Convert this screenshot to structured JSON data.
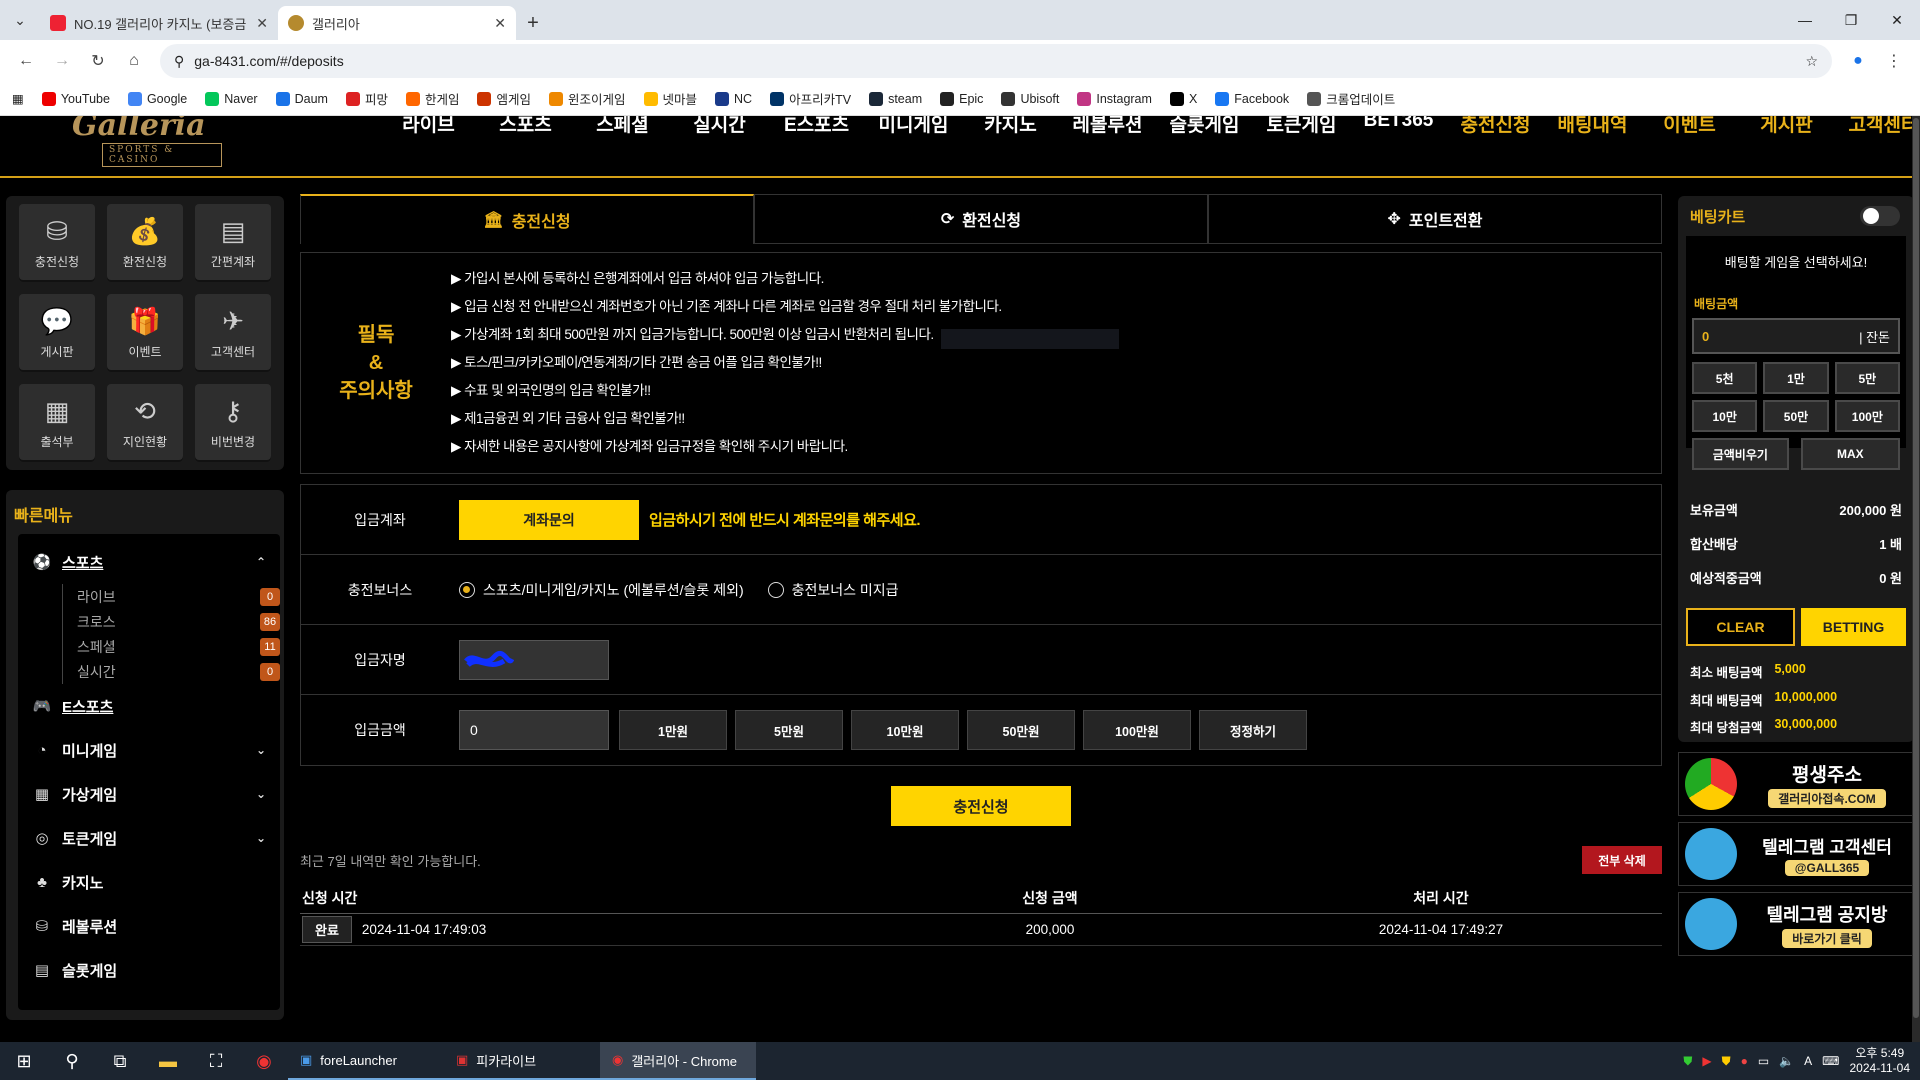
{
  "browser": {
    "tabs": [
      {
        "title": "NO.19 갤러리아 카지노 (보증금",
        "active": false
      },
      {
        "title": "갤러리아",
        "active": true
      }
    ],
    "url": "ga-8431.com/#/deposits",
    "bookmarks": [
      "YouTube",
      "Google",
      "Naver",
      "Daum",
      "피망",
      "한게임",
      "엠게임",
      "윈조이게임",
      "넷마블",
      "NC",
      "아프리카TV",
      "steam",
      "Epic",
      "Ubisoft",
      "Instagram",
      "X",
      "Facebook",
      "크롬업데이트"
    ]
  },
  "site": {
    "logo": {
      "main": "Galleria",
      "sub": "SPORTS & CASINO"
    },
    "nav": [
      "라이브",
      "스포츠",
      "스페셜",
      "실시간",
      "E스포츠",
      "미니게임",
      "카지노",
      "레볼루션",
      "슬롯게임",
      "토큰게임",
      "BET365",
      "충전신청",
      "배팅내역",
      "이벤트",
      "게시판",
      "고객센터"
    ]
  },
  "left": {
    "quick": [
      {
        "label": "충전신청",
        "icon": "coins-icon"
      },
      {
        "label": "환전신청",
        "icon": "money-bag-icon"
      },
      {
        "label": "간편계좌",
        "icon": "receipt-icon"
      },
      {
        "label": "게시판",
        "icon": "chat-bubble-icon"
      },
      {
        "label": "이벤트",
        "icon": "gift-icon"
      },
      {
        "label": "고객센터",
        "icon": "paper-plane-icon"
      },
      {
        "label": "출석부",
        "icon": "calendar-icon"
      },
      {
        "label": "지인현황",
        "icon": "referral-icon"
      },
      {
        "label": "비번변경",
        "icon": "key-icon"
      }
    ],
    "quick_title": "빠른메뉴",
    "sports": {
      "label": "스포츠",
      "subs": [
        {
          "label": "라이브",
          "count": "0"
        },
        {
          "label": "크로스",
          "count": "86"
        },
        {
          "label": "스페셜",
          "count": "11"
        },
        {
          "label": "실시간",
          "count": "0"
        }
      ]
    },
    "menu": [
      {
        "label": "E스포츠",
        "icon": "gamepad-icon",
        "chev": false
      },
      {
        "label": "미니게임",
        "icon": "mini-game-icon",
        "chev": true
      },
      {
        "label": "가상게임",
        "icon": "bet365-icon",
        "chev": true
      },
      {
        "label": "토큰게임",
        "icon": "token-icon",
        "chev": true
      },
      {
        "label": "카지노",
        "icon": "clover-icon",
        "chev": false
      },
      {
        "label": "레볼루션",
        "icon": "chip-icon",
        "chev": false
      },
      {
        "label": "슬롯게임",
        "icon": "slot-icon",
        "chev": false
      }
    ]
  },
  "main": {
    "tabs": [
      "충전신청",
      "환전신청",
      "포인트전환"
    ],
    "notice_title": [
      "필독",
      "&",
      "주의사항"
    ],
    "notices": [
      "▶ 가입시 본사에 등록하신 은행계좌에서 입금 하셔야 입금 가능합니다.",
      "▶ 입금 신청 전 안내받으신 계좌번호가 아닌 기존 계좌나 다른 계좌로 입금할 경우 절대 처리 불가합니다.",
      "▶ 가상계좌 1회 최대 500만원 까지 입금가능합니다. 500만원 이상 입금시 반환처리 됩니다.",
      "▶ 토스/핀크/카카오페이/연동계좌/기타 간편 송금 어플 입금 확인불가!!",
      "▶ 수표 및 외국인명의 입금 확인불가!!",
      "▶ 제1금융권 외 기타 금융사 입금 확인불가!!",
      "▶ 자세한 내용은 공지사항에 가상계좌 입금규정을 확인해 주시기 바랍니다."
    ],
    "form": {
      "account_label": "입금계좌",
      "account_button": "계좌문의",
      "account_warning": "입금하시기 전에 반드시 계좌문의를 해주세요.",
      "bonus_label": "충전보너스",
      "bonus_options": [
        "스포츠/미니게임/카지노 (에볼루션/슬롯 제외)",
        "충전보너스 미지급"
      ],
      "name_label": "입금자명",
      "amount_label": "입금금액",
      "amount_value": "0",
      "amount_buttons": [
        "1만원",
        "5만원",
        "10만원",
        "50만원",
        "100만원",
        "정정하기"
      ]
    },
    "submit": "충전신청",
    "history_note": "최근 7일 내역만 확인 가능합니다.",
    "delete_all": "전부 삭제",
    "history_cols": [
      "신청 시간",
      "신청 금액",
      "처리 시간"
    ],
    "history": [
      {
        "status": "완료",
        "requested": "2024-11-04 17:49:03",
        "amount": "200,000",
        "processed": "2024-11-04 17:49:27"
      }
    ]
  },
  "betslip": {
    "title": "베팅카트",
    "prompt": "배팅할 게임을 선택하세요!",
    "amount_label": "배팅금액",
    "amount_value": "0",
    "balance_tag": "| 잔돈",
    "chips": [
      "5천",
      "1만",
      "5만",
      "10만",
      "50만",
      "100만"
    ],
    "clear_amount": "금액비우기",
    "max": "MAX",
    "holding_label": "보유금액",
    "holding": "200,000 원",
    "odds_label": "합산배당",
    "odds": "1 배",
    "expected_label": "예상적중금액",
    "expected": "0 원",
    "clear": "CLEAR",
    "betting": "BETTING",
    "min_label": "최소 배팅금액",
    "min": "5,000",
    "max_label": "최대 배팅금액",
    "max_amount": "10,000,000",
    "win_label": "최대 당첨금액",
    "win": "30,000,000"
  },
  "banners": [
    {
      "t1": "평생주소",
      "t2": "갤러리아접속.COM"
    },
    {
      "t1": "텔레그램 고객센터",
      "t2": "@GALL365"
    },
    {
      "t1": "텔레그램 공지방",
      "t2": "바로가기 클릭"
    }
  ],
  "taskbar": {
    "apps": [
      "foreLauncher",
      "피카라이브",
      "갤러리아 - Chrome"
    ],
    "time": "오후 5:49",
    "date": "2024-11-04"
  }
}
